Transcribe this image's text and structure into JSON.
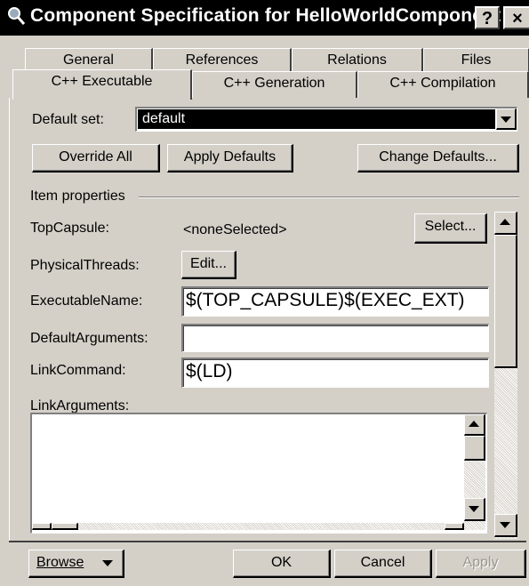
{
  "window": {
    "title": "Component Specification for HelloWorldComponent",
    "help_label": "?",
    "close_label": "×"
  },
  "tabs": {
    "back_row": [
      "General",
      "References",
      "Relations",
      "Files"
    ],
    "front_row": [
      "C++ Executable",
      "C++ Generation",
      "C++ Compilation"
    ],
    "active": "C++ Executable"
  },
  "default_set": {
    "label": "Default set:",
    "value": "default"
  },
  "actions": {
    "override_all": "Override All",
    "apply_defaults": "Apply Defaults",
    "change_defaults": "Change Defaults..."
  },
  "item_properties": {
    "group_label": "Item properties",
    "top_capsule_label": "TopCapsule:",
    "top_capsule_value": "<noneSelected>",
    "select_button": "Select...",
    "physical_threads_label": "PhysicalThreads:",
    "edit_button": "Edit...",
    "executable_name_label": "ExecutableName:",
    "executable_name_value": "$(TOP_CAPSULE)$(EXEC_EXT)",
    "default_arguments_label": "DefaultArguments:",
    "default_arguments_value": "",
    "link_command_label": "LinkCommand:",
    "link_command_value": "$(LD)",
    "link_arguments_label": "LinkArguments:",
    "link_arguments_value": ""
  },
  "footer": {
    "browse": "Browse",
    "ok": "OK",
    "cancel": "Cancel",
    "apply": "Apply"
  },
  "colors": {
    "face": "#d4d0c8",
    "titlebar": "#000000",
    "selection": "#000000"
  }
}
